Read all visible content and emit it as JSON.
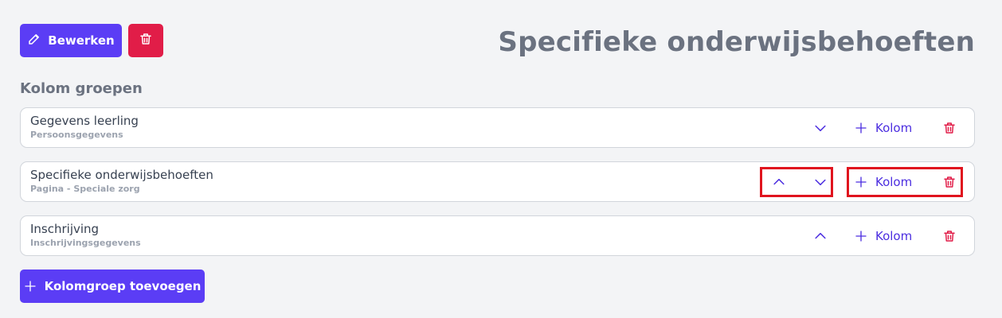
{
  "toolbar": {
    "edit_label": "Bewerken",
    "edit_icon": "pencil-icon",
    "delete_icon": "trash-icon"
  },
  "page_title": "Specifieke onderwijsbehoeften",
  "section_heading": "Kolom groepen",
  "groups": [
    {
      "name": "Gegevens leerling",
      "subtitle": "Persoonsgegevens",
      "can_move_up": false,
      "can_move_down": true,
      "add_label": "Kolom"
    },
    {
      "name": "Specifieke onderwijsbehoeften",
      "subtitle": "Pagina - Speciale zorg",
      "can_move_up": true,
      "can_move_down": true,
      "add_label": "Kolom"
    },
    {
      "name": "Inschrijving",
      "subtitle": "Inschrijvingsgegevens",
      "can_move_up": true,
      "can_move_down": false,
      "add_label": "Kolom"
    }
  ],
  "add_group_label": "Kolomgroep toevoegen",
  "colors": {
    "primary": "#5b3df5",
    "danger": "#e11d48",
    "link": "#4c2ee0",
    "highlight": "#e0141e"
  }
}
